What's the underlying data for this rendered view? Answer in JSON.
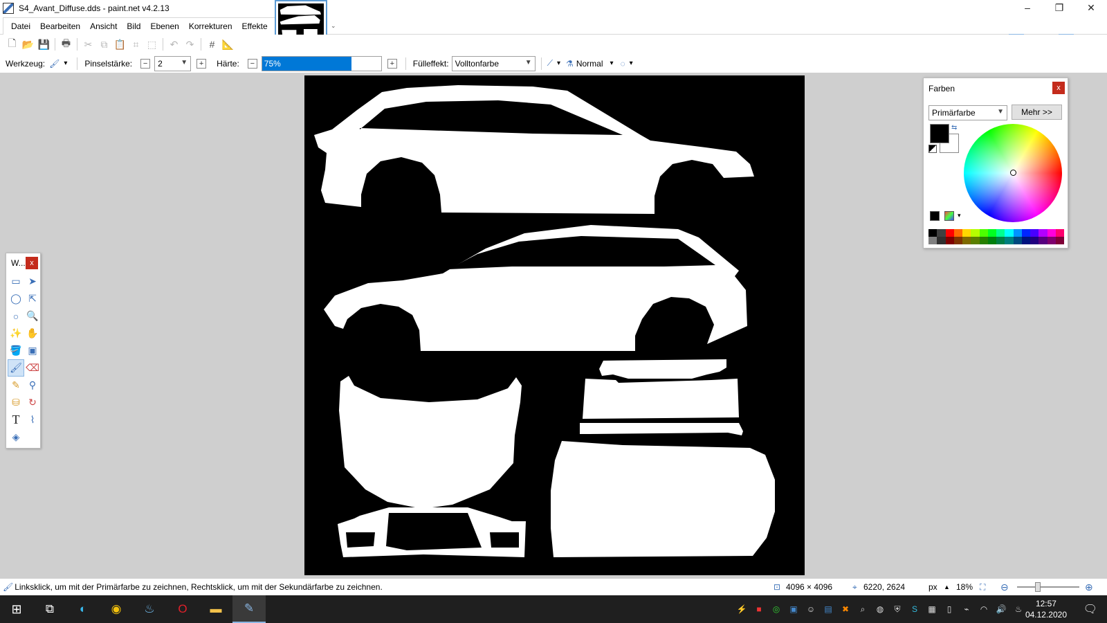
{
  "window": {
    "title": "S4_Avant_Diffuse.dds - paint.net v4.2.13",
    "min": "–",
    "restore": "❐",
    "close": "✕"
  },
  "menu": [
    "Datei",
    "Bearbeiten",
    "Ansicht",
    "Bild",
    "Ebenen",
    "Korrekturen",
    "Effekte"
  ],
  "thumb_caret": "⌄",
  "right_buttons": [
    "tools-window-icon",
    "history-window-icon",
    "layers-window-icon",
    "colors-window-icon",
    "settings-icon",
    "help-icon"
  ],
  "toolbar_icons": [
    "new-icon",
    "open-icon",
    "save-icon",
    "print-icon",
    "cut-icon",
    "copy-icon",
    "paste-icon",
    "crop-icon",
    "deselect-icon",
    "undo-icon",
    "redo-icon",
    "grid-icon",
    "ruler-icon"
  ],
  "options": {
    "tool_label": "Werkzeug:",
    "brush_label": "Pinselstärke:",
    "brush_value": "2",
    "hardness_label": "Härte:",
    "hardness_value": "75%",
    "hardness_fraction": 0.75,
    "fill_label": "Fülleffekt:",
    "fill_value": "Volltonfarbe",
    "blend_value": "Normal",
    "minus": "−",
    "plus": "+",
    "caret": "▾"
  },
  "tools_window": {
    "title": "W...",
    "close": "x"
  },
  "tools": [
    "rectangle-select",
    "move-selection",
    "lasso-select",
    "move-selected",
    "ellipse-select",
    "zoom",
    "magic-wand",
    "pan",
    "paint-bucket",
    "gradient",
    "paintbrush",
    "eraser",
    "pencil",
    "color-picker",
    "clone-stamp",
    "recolor",
    "text",
    "line-curve",
    "shapes",
    ""
  ],
  "colors_window": {
    "title": "Farben",
    "close": "x",
    "primary_select": "Primärfarbe",
    "more_button": "Mehr >>",
    "primary_color": "#000000",
    "secondary_color": "#ffffff",
    "palette": [
      "#000000",
      "#404040",
      "#ff0000",
      "#ff6a00",
      "#ffd800",
      "#b6ff00",
      "#4cff00",
      "#00ff21",
      "#00ff90",
      "#00ffff",
      "#0094ff",
      "#0026ff",
      "#4800ff",
      "#b200ff",
      "#ff00dc",
      "#ff006e",
      "#808080",
      "#303030",
      "#7f0000",
      "#7f3300",
      "#7f6a00",
      "#5b7f00",
      "#267f00",
      "#007f0e",
      "#007f46",
      "#007f7f",
      "#004a7f",
      "#00137f",
      "#21007f",
      "#57007f",
      "#7f006e",
      "#7f0037"
    ]
  },
  "status": {
    "hint": "Linksklick, um mit der Primärfarbe zu zeichnen, Rechtsklick, um mit der Sekundärfarbe zu zeichnen.",
    "image_size": "4096 × 4096",
    "cursor_pos": "6220, 2624",
    "unit": "px",
    "zoom": "18%"
  },
  "taskbar": {
    "time": "12:57",
    "date": "04.12.2020",
    "apps": [
      "start-icon",
      "task-view-icon",
      "edge-icon",
      "chrome-icon",
      "steam-icon",
      "opera-icon",
      "explorer-icon",
      "paintnet-icon"
    ]
  }
}
